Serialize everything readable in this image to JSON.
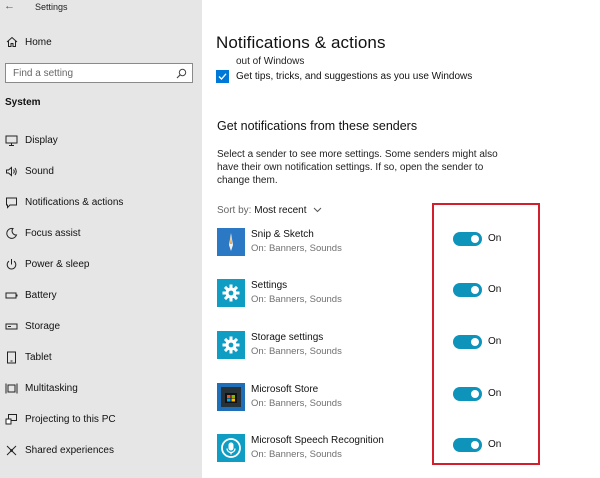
{
  "window": {
    "title": "Settings"
  },
  "sidebar": {
    "home_label": "Home",
    "search_placeholder": "Find a setting",
    "section_label": "System",
    "items": [
      {
        "label": "Display",
        "icon": "display-icon"
      },
      {
        "label": "Sound",
        "icon": "sound-icon"
      },
      {
        "label": "Notifications & actions",
        "icon": "notifications-icon"
      },
      {
        "label": "Focus assist",
        "icon": "moon-icon"
      },
      {
        "label": "Power & sleep",
        "icon": "power-icon"
      },
      {
        "label": "Battery",
        "icon": "battery-icon"
      },
      {
        "label": "Storage",
        "icon": "storage-icon"
      },
      {
        "label": "Tablet",
        "icon": "tablet-icon"
      },
      {
        "label": "Multitasking",
        "icon": "multitasking-icon"
      },
      {
        "label": "Projecting to this PC",
        "icon": "projecting-icon"
      },
      {
        "label": "Shared experiences",
        "icon": "shared-experiences-icon"
      }
    ]
  },
  "main": {
    "title": "Notifications & actions",
    "cut_off_text": "out of Windows",
    "tips_label": "Get tips, tricks, and suggestions as you use Windows",
    "tips_checked": true,
    "senders_heading": "Get notifications from these senders",
    "senders_description": "Select a sender to see more settings. Some senders might also have their own notification settings. If so, open the sender to change them.",
    "sort_label": "Sort by:",
    "sort_value": "Most recent",
    "senders": [
      {
        "name": "Snip & Sketch",
        "subtitle": "On: Banners, Sounds",
        "toggle_state": "On",
        "icon": "snip-sketch-icon"
      },
      {
        "name": "Settings",
        "subtitle": "On: Banners, Sounds",
        "toggle_state": "On",
        "icon": "settings-gear-icon"
      },
      {
        "name": "Storage settings",
        "subtitle": "On: Banners, Sounds",
        "toggle_state": "On",
        "icon": "storage-settings-gear-icon"
      },
      {
        "name": "Microsoft Store",
        "subtitle": "On: Banners, Sounds",
        "toggle_state": "On",
        "icon": "microsoft-store-icon"
      },
      {
        "name": "Microsoft Speech Recognition",
        "subtitle": "On: Banners, Sounds",
        "toggle_state": "On",
        "icon": "speech-recognition-icon"
      }
    ]
  },
  "colors": {
    "accent": "#0078d7",
    "toggle_on": "#0e93ba",
    "sidebar_bg": "#e6e6e6",
    "highlight_border": "#d21f2d",
    "app_tile": "#0f9dc4"
  }
}
